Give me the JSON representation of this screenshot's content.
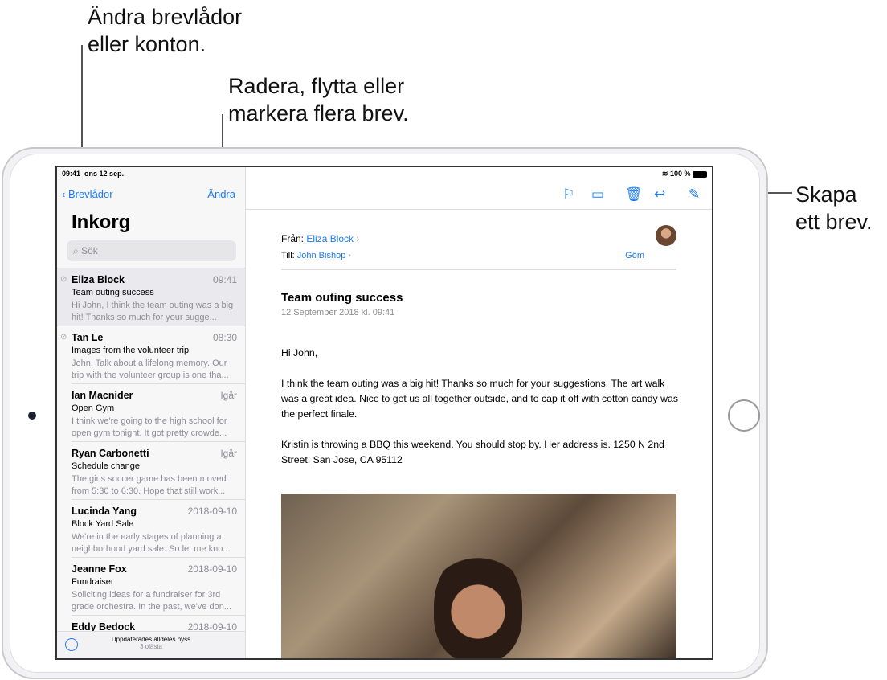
{
  "callouts": {
    "mailboxes": [
      "Ändra brevlådor",
      "eller konton."
    ],
    "edit": [
      "Radera, flytta eller",
      "markera flera brev."
    ],
    "compose": [
      "Skapa",
      "ett brev."
    ]
  },
  "status": {
    "time": "09:41",
    "date": "ons 12 sep.",
    "battery": "100 %"
  },
  "sidebar": {
    "back": "Brevlådor",
    "edit": "Ändra",
    "title": "Inkorg",
    "search_placeholder": "Sök",
    "items": [
      {
        "from": "Eliza Block",
        "time": "09:41",
        "subject": "Team outing success",
        "preview": "Hi John, I think the team outing was a big hit! Thanks so much for your sugge...",
        "attachment": true
      },
      {
        "from": "Tan Le",
        "time": "08:30",
        "subject": "Images from the volunteer trip",
        "preview": "John, Talk about a lifelong memory. Our trip with the volunteer group is one tha...",
        "attachment": true
      },
      {
        "from": "Ian Macnider",
        "time": "Igår",
        "subject": "Open Gym",
        "preview": "I think we're going to the high school for open gym tonight. It got pretty crowde..."
      },
      {
        "from": "Ryan Carbonetti",
        "time": "Igår",
        "subject": "Schedule change",
        "preview": "The girls soccer game has been moved from 5:30 to 6:30. Hope that still work..."
      },
      {
        "from": "Lucinda Yang",
        "time": "2018-09-10",
        "subject": "Block Yard Sale",
        "preview": "We're in the early stages of planning a neighborhood yard sale. So let me kno..."
      },
      {
        "from": "Jeanne Fox",
        "time": "2018-09-10",
        "subject": "Fundraiser",
        "preview": "Soliciting ideas for a fundraiser for 3rd grade orchestra. In the past, we've don..."
      },
      {
        "from": "Eddy Bedock",
        "time": "2018-09-10",
        "subject": "",
        "preview": ""
      }
    ],
    "footer": {
      "updated": "Uppdaterades alldeles nyss",
      "unread": "3 olästa"
    }
  },
  "message": {
    "from_label": "Från:",
    "from": "Eliza Block",
    "to_label": "Till:",
    "to": "John Bishop",
    "hide": "Göm",
    "subject": "Team outing success",
    "date": "12 September 2018 kl. 09:41",
    "paragraphs": [
      "Hi John,",
      "I think the team outing was a big hit! Thanks so much for your suggestions. The art walk was a great idea. Nice to get us all together outside, and to cap it off with cotton candy was the perfect finale.",
      "Kristin is throwing a BBQ this weekend. You should stop by. Her address is. 1250 N 2nd Street, San Jose, CA 95112"
    ]
  },
  "colors": {
    "accent": "#1a7cf5"
  }
}
